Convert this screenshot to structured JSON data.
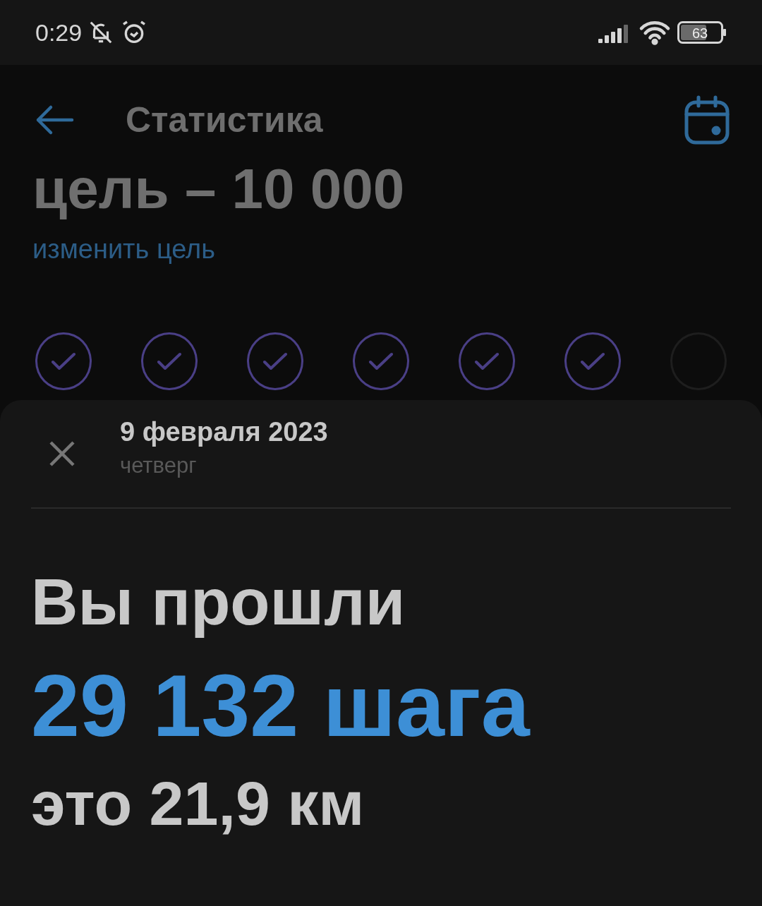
{
  "status_bar": {
    "time": "0:29",
    "battery": "63"
  },
  "header": {
    "title": "Статистика"
  },
  "goal": {
    "title": "цель – 10 000",
    "link": "изменить цель"
  },
  "days": [
    {
      "checked": true
    },
    {
      "checked": true
    },
    {
      "checked": true
    },
    {
      "checked": true
    },
    {
      "checked": true
    },
    {
      "checked": true
    },
    {
      "checked": false
    }
  ],
  "sheet": {
    "date": "9 февраля 2023",
    "weekday": "четверг",
    "lead": "Вы прошли",
    "steps": "29 132 шага",
    "distance": "это 21,9 км"
  }
}
